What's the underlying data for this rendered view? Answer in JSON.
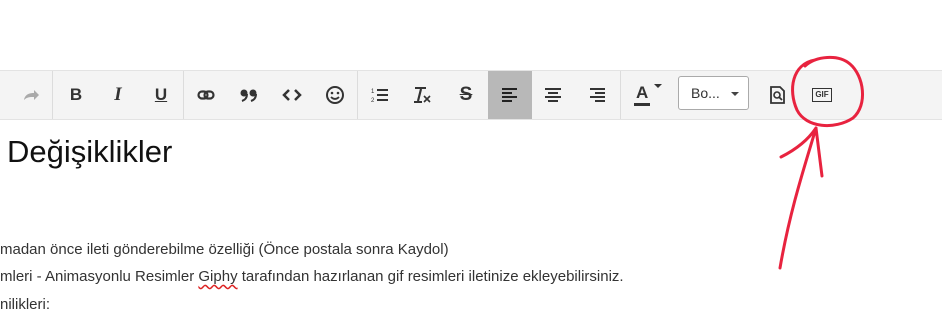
{
  "toolbar": {
    "buttons": [
      {
        "name": "redo-button",
        "icon": "redo-icon"
      },
      {
        "name": "bold-button",
        "label": "B"
      },
      {
        "name": "italic-button",
        "label": "I"
      },
      {
        "name": "underline-button",
        "label": "U"
      },
      {
        "name": "link-button",
        "icon": "link-icon"
      },
      {
        "name": "blockquote-button",
        "icon": "quote-icon"
      },
      {
        "name": "code-button",
        "icon": "code-icon"
      },
      {
        "name": "emoji-button",
        "icon": "smiley-icon"
      },
      {
        "name": "ordered-list-button",
        "icon": "numbered-list-icon"
      },
      {
        "name": "clear-format-button",
        "icon": "clear-format-icon"
      },
      {
        "name": "strikethrough-button",
        "label": "S"
      },
      {
        "name": "align-left-button",
        "icon": "align-left-icon",
        "active": true
      },
      {
        "name": "align-center-button",
        "icon": "align-center-icon"
      },
      {
        "name": "align-right-button",
        "icon": "align-right-icon"
      },
      {
        "name": "font-color-button",
        "label": "A"
      },
      {
        "name": "preview-button",
        "icon": "preview-icon"
      },
      {
        "name": "gif-button",
        "label": "GIF"
      }
    ],
    "font_dropdown_value": "Bo...",
    "active_color": "#b8b8b8"
  },
  "content": {
    "heading": "Değişiklikler",
    "line1": "madan önce ileti gönderebilme özelliği (Önce postala sonra Kaydol)",
    "line2_before": "mleri - Animasyonlu Resimler ",
    "line2_misspelled": "Giphy",
    "line2_after": " tarafından hazırlanan gif resimleri iletinize ekleyebilirsiniz.",
    "line3": "nilikleri:"
  },
  "annotation": {
    "color": "#e8233f",
    "shape": "hand-drawn circle with arrow pointing to the GIF button"
  }
}
